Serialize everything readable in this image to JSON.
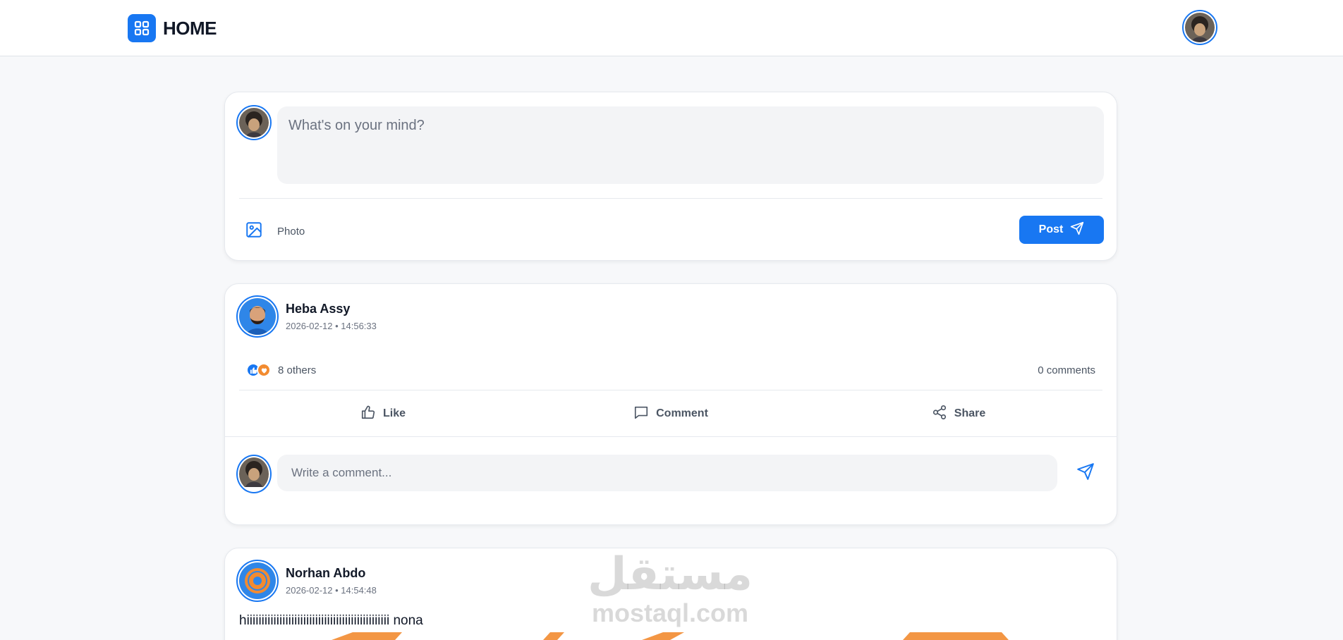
{
  "header": {
    "title": "HOME",
    "logo_icon": "grid-icon",
    "accent": "#1877f2"
  },
  "composer": {
    "placeholder": "What's on your mind?",
    "photo_label": "Photo",
    "post_label": "Post"
  },
  "posts": [
    {
      "author": "Heba Assy",
      "timestamp": "2026-02-12 • 14:56:33",
      "reactions_text": "8 others",
      "comments_text": "0 comments",
      "actions": {
        "like": "Like",
        "comment": "Comment",
        "share": "Share"
      },
      "comment_placeholder": "Write a comment..."
    },
    {
      "author": "Norhan Abdo",
      "timestamp": "2026-02-12 • 14:54:48",
      "body": "hiiiiiiiiiiiiiiiiiiiiiiiiiiiiiiiiiiiiiiiiiiiiiiii nona"
    }
  ],
  "watermark": {
    "arabic": "مستقل",
    "latin": "mostaql.com"
  }
}
